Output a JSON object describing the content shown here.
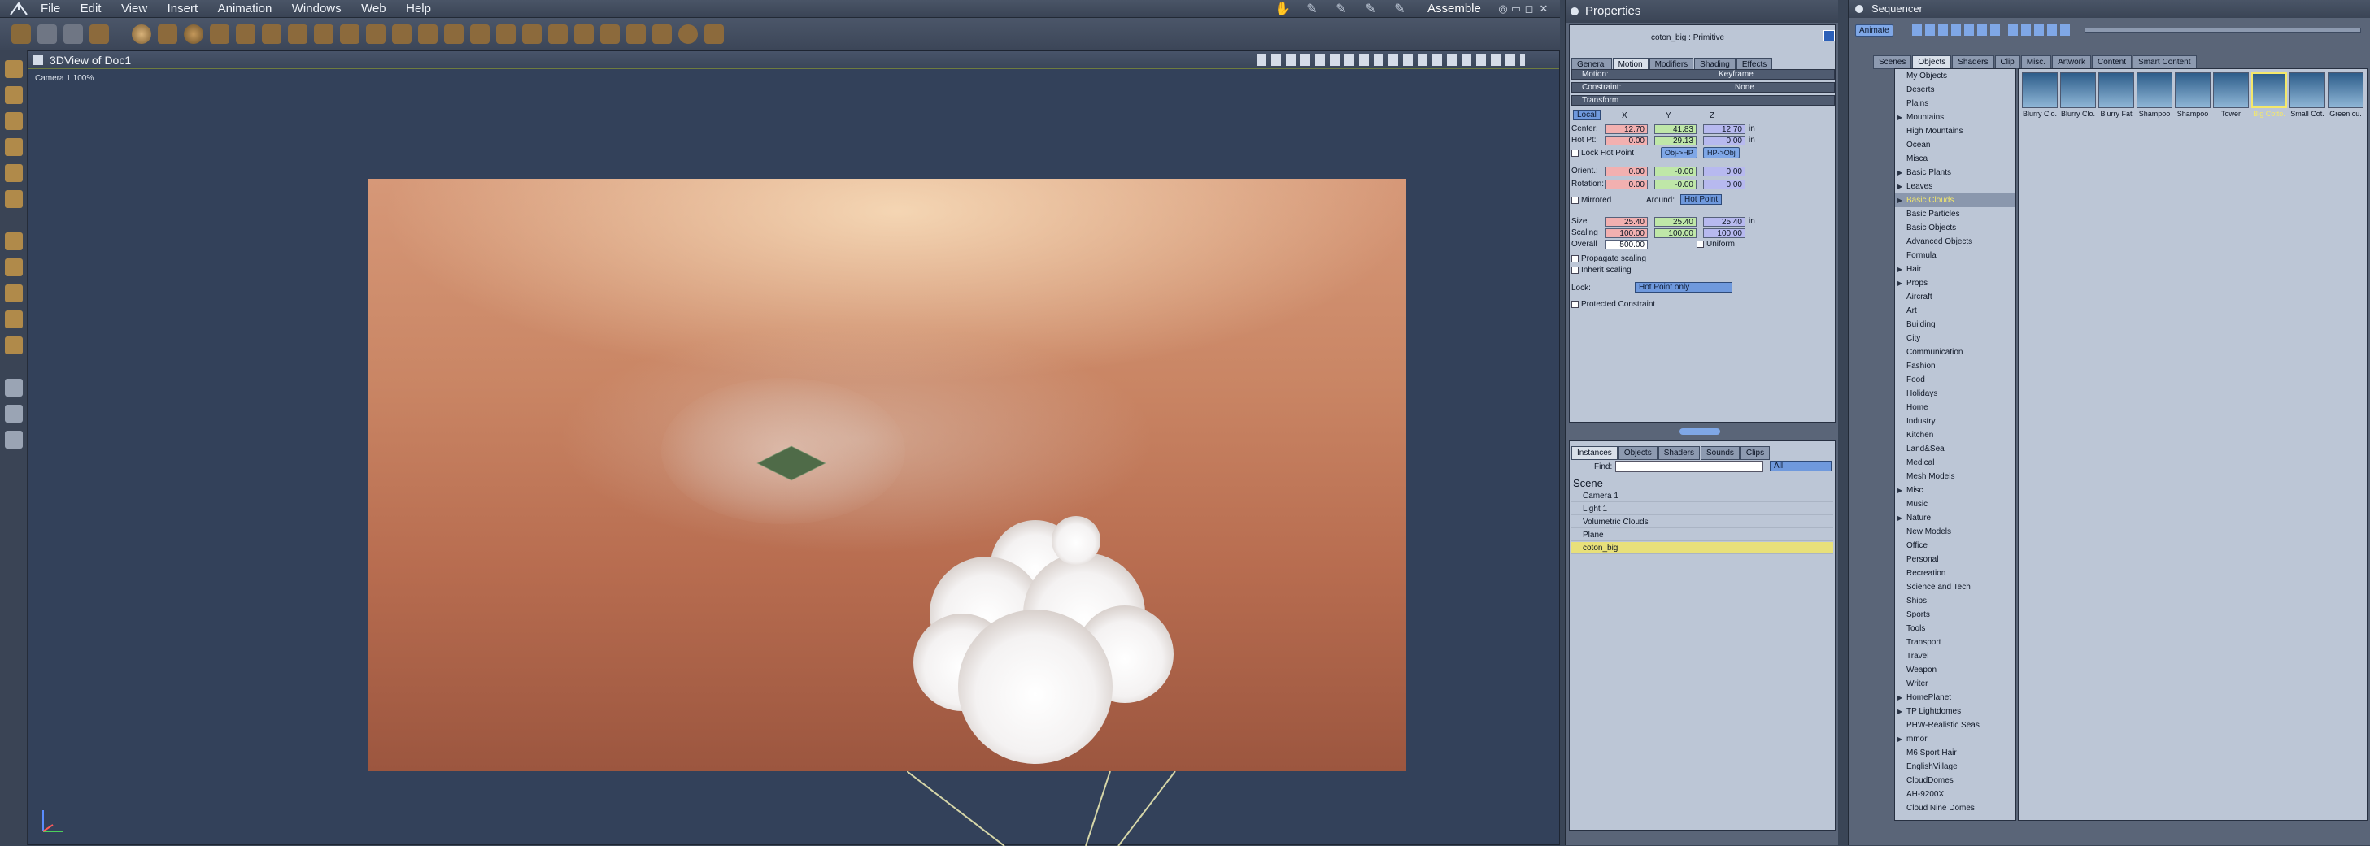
{
  "menubar": {
    "items": [
      "File",
      "Edit",
      "View",
      "Insert",
      "Animation",
      "Windows",
      "Web",
      "Help"
    ],
    "room_label": "Assemble"
  },
  "viewport": {
    "title": "3DView of Doc1",
    "camera_label": "Camera 1 100%"
  },
  "properties": {
    "title": "Properties",
    "object_name": "coton_big : Primitive",
    "tabs": [
      "General",
      "Motion",
      "Modifiers",
      "Shading",
      "Effects"
    ],
    "active_tab": "Motion",
    "motion_label": "Motion:",
    "motion_value": "Keyframe",
    "constraint_label": "Constraint:",
    "constraint_value": "None",
    "transform_label": "Transform",
    "space_dropdown": "Local",
    "axis_x": "X",
    "axis_y": "Y",
    "axis_z": "Z",
    "center_label": "Center:",
    "center": [
      "12.70",
      "41.83",
      "12.70"
    ],
    "hotpt_label": "Hot Pt:",
    "hotpt": [
      "0.00",
      "29.13",
      "0.00"
    ],
    "unit": "in",
    "lock_hot_point": "Lock Hot Point",
    "obj_hp_btn": "Obj->HP",
    "hp_obj_btn": "HP->Obj",
    "orient_label": "Orient.:",
    "orient": [
      "0.00",
      "-0.00",
      "0.00"
    ],
    "rotation_label": "Rotation:",
    "rotation": [
      "0.00",
      "-0.00",
      "0.00"
    ],
    "mirrored": "Mirrored",
    "around_label": "Around:",
    "around_value": "Hot Point",
    "size_label": "Size",
    "size": [
      "25.40",
      "25.40",
      "25.40"
    ],
    "scaling_label": "Scaling",
    "scaling": [
      "100.00",
      "100.00",
      "100.00"
    ],
    "overall_label": "Overall",
    "overall": "500.00",
    "uniform": "Uniform",
    "propagate_scaling": "Propagate scaling",
    "inherit_scaling": "Inherit scaling",
    "lock_label": "Lock:",
    "lock_value": "Hot Point only",
    "protected_constraint": "Protected Constraint"
  },
  "instances": {
    "tabs": [
      "Instances",
      "Objects",
      "Shaders",
      "Sounds",
      "Clips"
    ],
    "find_label": "Find:",
    "find_value": "",
    "filter_value": "All",
    "scene_header": "Scene",
    "items": [
      "Camera 1",
      "Light 1",
      "Volumetric Clouds",
      "Plane",
      "coton_big"
    ],
    "selected": "coton_big"
  },
  "sequencer": {
    "title": "Sequencer",
    "browser_button": "Animate",
    "tabs": [
      "Scenes",
      "Objects",
      "Shaders",
      "Clip",
      "Misc.",
      "Artwork",
      "Content",
      "Smart Content"
    ],
    "active_tab": "Objects",
    "tree": [
      "My Objects",
      "Deserts",
      "Plains",
      "Mountains",
      "High Mountains",
      "Ocean",
      "Misca",
      "Basic Plants",
      "Leaves",
      "Basic Clouds",
      "Basic Particles",
      "Basic Objects",
      "Advanced Objects",
      "Formula",
      "Hair",
      "Props",
      "Aircraft",
      "Art",
      "Building",
      "City",
      "Communication",
      "Fashion",
      "Food",
      "Holidays",
      "Home",
      "Industry",
      "Kitchen",
      "Land&Sea",
      "Medical",
      "Mesh Models",
      "Misc",
      "Music",
      "Nature",
      "New Models",
      "Office",
      "Personal",
      "Recreation",
      "Science and Tech",
      "Ships",
      "Sports",
      "Tools",
      "Transport",
      "Travel",
      "Weapon",
      "Writer",
      "HomePlanet",
      "TP Lightdomes",
      "PHW-Realistic Seas",
      "mmor",
      "M6 Sport Hair",
      "EnglishVillage",
      "CloudDomes",
      "AH-9200X",
      "Cloud Nine Domes"
    ],
    "tree_selected": "Basic Clouds",
    "thumbs": [
      "Blurry Clo.",
      "Blurry Clo.",
      "Blurry Fat",
      "Shampoo",
      "Shampoo",
      "Tower",
      "Big Cotto.",
      "Small Cot.",
      "Green cu."
    ],
    "thumb_selected": "Big Cotto."
  }
}
